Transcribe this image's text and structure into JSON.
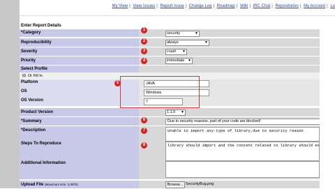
{
  "nav": [
    "My View",
    "View Issues",
    "Report Issue",
    "Change Log",
    "Roadmap",
    "Wiki",
    "IRC Chat",
    "Repositories",
    "My Account",
    "Lo"
  ],
  "section_title": "Enter Report Details",
  "fields": {
    "category": {
      "label": "*Category",
      "value": "security"
    },
    "reproducibility": {
      "label": "Reproducibility",
      "value": "always"
    },
    "severity": {
      "label": "Severity",
      "value": "crash"
    },
    "priority": {
      "label": "Priority",
      "value": "immediate"
    },
    "select_profile": {
      "label": "Select Profile"
    },
    "or_fill_in": {
      "label": "Or Fill In",
      "toggle": "⊟"
    },
    "platform": {
      "label": "Platform",
      "value": "JAVA"
    },
    "os": {
      "label": "OS",
      "value": "Windows"
    },
    "os_version": {
      "label": "OS Version",
      "value": "7"
    },
    "product_version": {
      "label": "Product Version",
      "value": "1.1.0"
    },
    "summary": {
      "label": "*Summary",
      "value": "Due to security reasons, part of your code are blocked!"
    },
    "description": {
      "label": "*Description",
      "value": "Unable to import any-type of library,due to security reason"
    },
    "steps": {
      "label": "Steps To Reproduce",
      "value": "library should import and the content related to library should execute"
    },
    "additional": {
      "label": "Additional Information"
    },
    "upload": {
      "label": "Upload File",
      "hint": "(Maximum size: 2,097k)",
      "button": "Browse...",
      "filename": "SecurityBug.png"
    }
  },
  "badges": [
    "1",
    "2",
    "3",
    "4",
    "5",
    "6",
    "7",
    "8"
  ],
  "colors": {
    "label_bg": "#c8c8e8",
    "value_bg": "#d8d8d8",
    "badge": "#d02828",
    "link": "#1f3fbf"
  }
}
